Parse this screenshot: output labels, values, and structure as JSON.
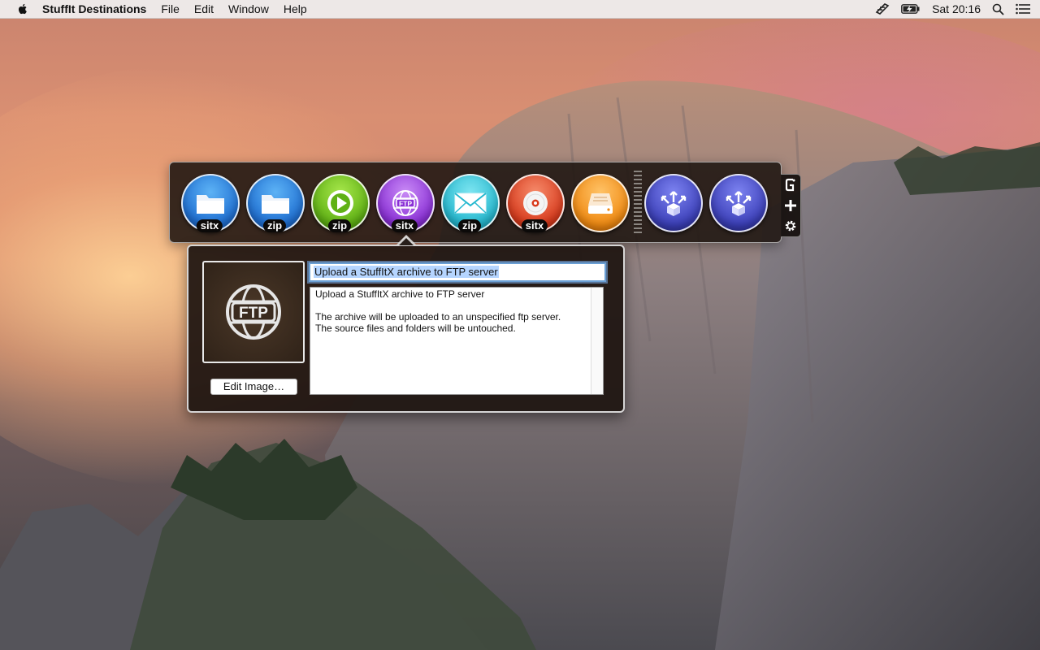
{
  "menubar": {
    "app_name": "StuffIt Destinations",
    "menus": [
      "File",
      "Edit",
      "Window",
      "Help"
    ],
    "clock": "Sat 20:16",
    "icons": [
      "apple-icon",
      "stuffit-status-icon",
      "battery-charging-icon",
      "spotlight-search-icon",
      "notification-center-icon"
    ]
  },
  "toolbar": {
    "destinations": [
      {
        "tag": "sitx",
        "icon": "folder-icon",
        "color": "#2a7fd8"
      },
      {
        "tag": "zip",
        "icon": "folder-icon",
        "color": "#2a7fd8"
      },
      {
        "tag": "zip",
        "icon": "play-icon",
        "color": "#6cbf1e"
      },
      {
        "tag": "sitx",
        "icon": "ftp-globe-icon",
        "color": "#8a2fd6"
      },
      {
        "tag": "zip",
        "icon": "mail-icon",
        "color": "#25b8cf"
      },
      {
        "tag": "sitx",
        "icon": "disc-icon",
        "color": "#d83a1c"
      },
      {
        "tag": "",
        "icon": "drive-icon",
        "color": "#f08a12"
      },
      {
        "tag": "",
        "icon": "expand-box-icon",
        "color": "#3b3fb8"
      },
      {
        "tag": "",
        "icon": "expand-box-icon",
        "color": "#3b3fb8"
      }
    ],
    "side_controls": [
      "gesture-icon",
      "add-icon",
      "gear-icon"
    ]
  },
  "popover": {
    "image_label": "FTP",
    "edit_button": "Edit Image…",
    "title_value": "Upload a StuffItX archive to FTP server",
    "description_lines": [
      "Upload a StuffItX archive to FTP server",
      "",
      "The archive will be uploaded to an unspecified ftp server.",
      "The source files and folders will be untouched."
    ]
  }
}
